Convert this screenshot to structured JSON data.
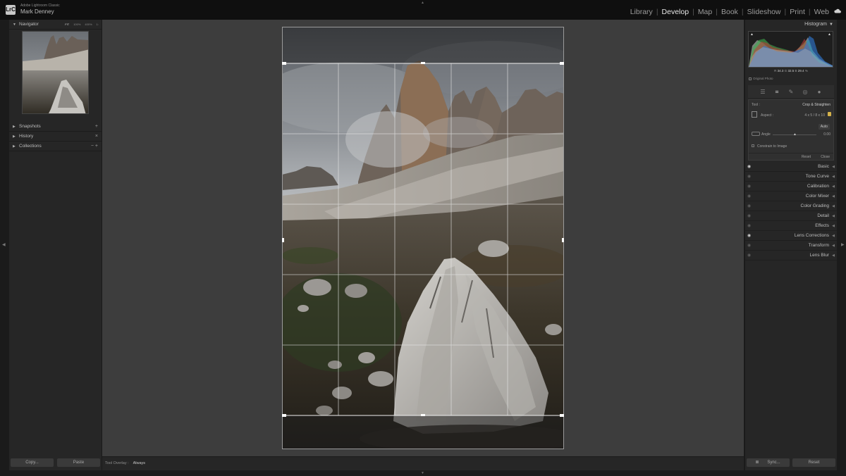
{
  "app": {
    "product": "Adobe Lightroom Classic",
    "user": "Mark Denney",
    "logo": "LrC",
    "modules": [
      {
        "label": "Library",
        "active": false
      },
      {
        "label": "Develop",
        "active": true
      },
      {
        "label": "Map",
        "active": false
      },
      {
        "label": "Book",
        "active": false
      },
      {
        "label": "Slideshow",
        "active": false
      },
      {
        "label": "Print",
        "active": false
      },
      {
        "label": "Web",
        "active": false
      }
    ]
  },
  "left": {
    "navigator": {
      "title": "Navigator",
      "zoom": [
        "FIT",
        "100%",
        "400%",
        "1:"
      ]
    },
    "sections": [
      {
        "label": "Snapshots",
        "control": "+"
      },
      {
        "label": "History",
        "control": "×"
      },
      {
        "label": "Collections",
        "control": "− +"
      }
    ],
    "copy": "Copy...",
    "paste": "Paste"
  },
  "toolbar": {
    "label": "Tool Overlay :",
    "value": "Always"
  },
  "right": {
    "histogram": {
      "title": "Histogram",
      "readout": {
        "r_label": "R",
        "r": "34.3",
        "g_label": "G",
        "g": "32.5",
        "b_label": "B",
        "b": "29.4",
        "unit": "%"
      }
    },
    "original_photo": "Original Photo",
    "crop": {
      "tool_label": "Tool :",
      "tool_name": "Crop & Straighten",
      "aspect_label": "Aspect :",
      "aspect_value": "4 x 5  /  8 x 10",
      "auto": "Auto",
      "angle_label": "Angle",
      "angle_value": "0.00",
      "constrain": "Constrain to Image",
      "reset": "Reset",
      "close": "Close"
    },
    "sections": [
      {
        "label": "Basic",
        "eye": true
      },
      {
        "label": "Tone Curve",
        "eye": false
      },
      {
        "label": "Calibration",
        "eye": false
      },
      {
        "label": "Color Mixer",
        "eye": false
      },
      {
        "label": "Color Grading",
        "eye": false
      },
      {
        "label": "Detail",
        "eye": false
      },
      {
        "label": "Effects",
        "eye": false
      },
      {
        "label": "Lens Corrections",
        "eye": true
      },
      {
        "label": "Transform",
        "eye": false
      },
      {
        "label": "Lens Blur",
        "eye": false
      }
    ],
    "sync": "Sync...",
    "reset": "Reset"
  },
  "colors": {
    "canvas": "#3d3d3d",
    "panel": "#262626",
    "active_module": "#e6e6e6"
  }
}
